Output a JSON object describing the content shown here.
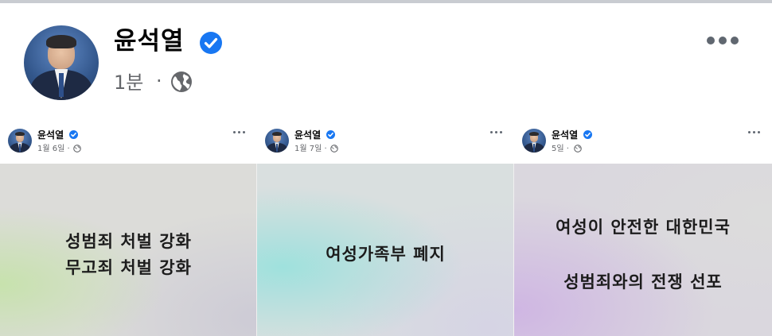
{
  "post": {
    "author": "윤석열",
    "time": "1분",
    "separator": "·"
  },
  "cards": [
    {
      "author": "윤석열",
      "time": "1월 6일 ·",
      "lines": [
        "성범죄 처벌 강화",
        "무고죄 처벌 강화"
      ]
    },
    {
      "author": "윤석열",
      "time": "1월 7일 ·",
      "lines": [
        "여성가족부 폐지"
      ]
    },
    {
      "author": "윤석열",
      "time": "5일 ·",
      "lines": [
        "여성이 안전한 대한민국",
        "성범죄와의 전쟁 선포"
      ]
    }
  ],
  "colors": {
    "verified": "#1877f2",
    "secondary_text": "#65676b",
    "topbar": "#c9ccd1"
  },
  "icons": {
    "verified": "verified-badge-icon",
    "audience": "globe-icon",
    "menu": "more-options-icon"
  }
}
